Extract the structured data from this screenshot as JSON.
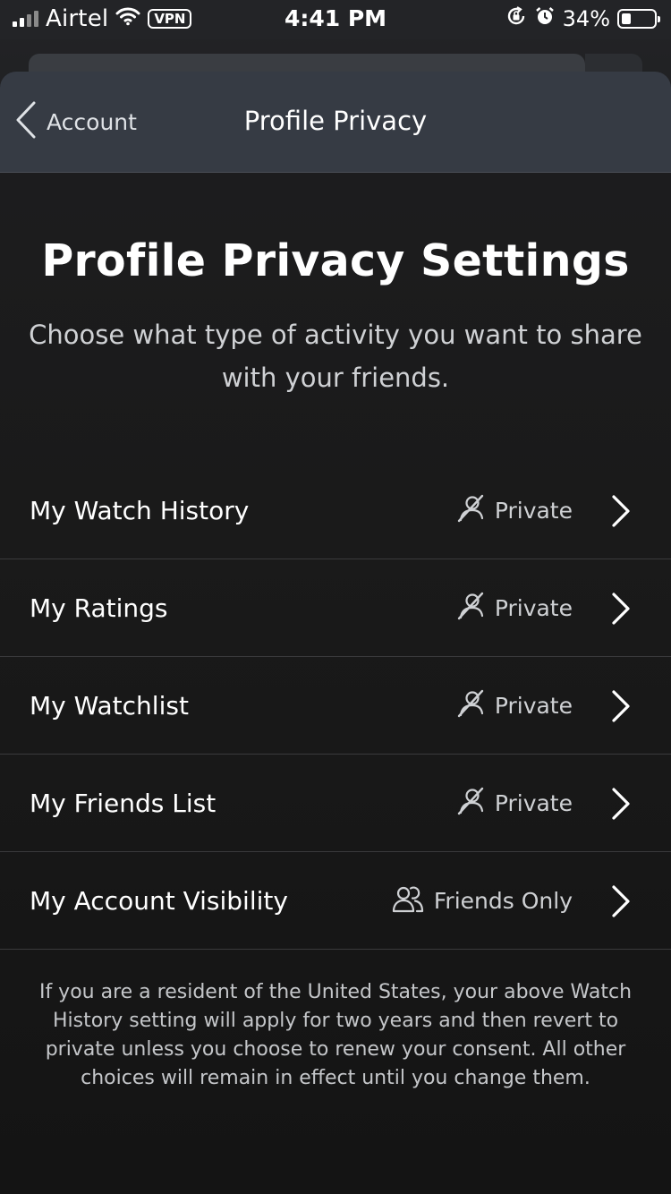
{
  "status_bar": {
    "carrier": "Airtel",
    "vpn": "VPN",
    "time": "4:41 PM",
    "battery": "34%",
    "battery_level": 0.34,
    "icons": [
      "signal-icon",
      "wifi-icon",
      "orientation-lock-icon",
      "alarm-icon",
      "battery-icon"
    ]
  },
  "navbar": {
    "back_label": "Account",
    "title": "Profile Privacy"
  },
  "content": {
    "heading": "Profile Privacy Settings",
    "subheading": "Choose what type of activity you want to share with your friends."
  },
  "settings": [
    {
      "label": "My Watch History",
      "value": "Private",
      "icon": "private-icon"
    },
    {
      "label": "My Ratings",
      "value": "Private",
      "icon": "private-icon"
    },
    {
      "label": "My Watchlist",
      "value": "Private",
      "icon": "private-icon"
    },
    {
      "label": "My Friends List",
      "value": "Private",
      "icon": "private-icon"
    },
    {
      "label": "My Account Visibility",
      "value": "Friends Only",
      "icon": "friends-icon"
    }
  ],
  "footnote": "If you are a resident of the United States, your above Watch History setting will apply for two years and then revert to private unless you choose to renew your consent. All other choices will remain in effect until you change them.",
  "colors": {
    "navbar_bg": "#363b44",
    "background": "#1a1a1a",
    "text_primary": "#ffffff",
    "text_secondary": "#cfd1d4",
    "divider": "#3a3a3c"
  }
}
